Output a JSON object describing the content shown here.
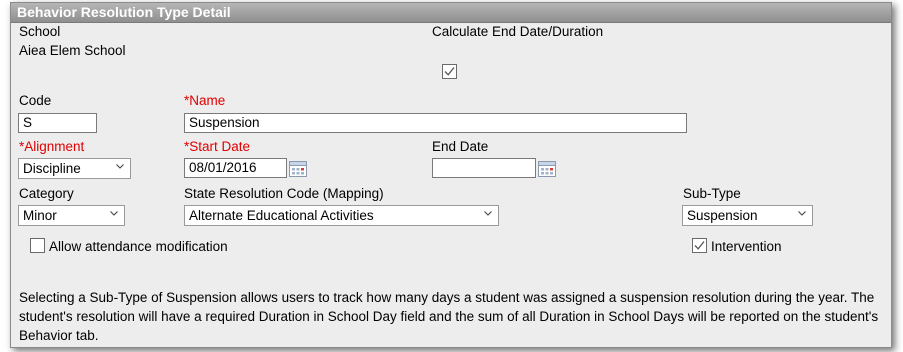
{
  "panel": {
    "title": "Behavior Resolution Type Detail"
  },
  "school": {
    "label": "School",
    "value": "Aiea Elem School"
  },
  "calculate_end": {
    "label": "Calculate End Date/Duration",
    "checked": true
  },
  "code": {
    "label": "Code",
    "value": "S"
  },
  "name": {
    "required_mark": "*",
    "label": "Name",
    "value": "Suspension"
  },
  "alignment": {
    "required_mark": "*",
    "label": "Alignment",
    "value": "Discipline"
  },
  "start_date": {
    "required_mark": "*",
    "label": "Start Date",
    "value": "08/01/2016"
  },
  "end_date": {
    "label": "End Date",
    "value": ""
  },
  "category": {
    "label": "Category",
    "value": "Minor"
  },
  "state_code": {
    "label": "State Resolution Code (Mapping)",
    "value": "Alternate Educational Activities"
  },
  "sub_type": {
    "label": "Sub-Type",
    "value": "Suspension"
  },
  "allow_attendance": {
    "label": "Allow attendance modification",
    "checked": false
  },
  "intervention": {
    "label": "Intervention",
    "checked": true
  },
  "description": "Selecting a Sub-Type of Suspension allows users to track how many days a student was assigned a suspension resolution during the year. The student's resolution will have a required Duration in School Day field and the sum of all Duration in School Days will be reported on the student's Behavior tab.",
  "colors": {
    "required": "#e00000",
    "header_bg": "#a3a3a3",
    "panel_bg": "#ededed"
  }
}
